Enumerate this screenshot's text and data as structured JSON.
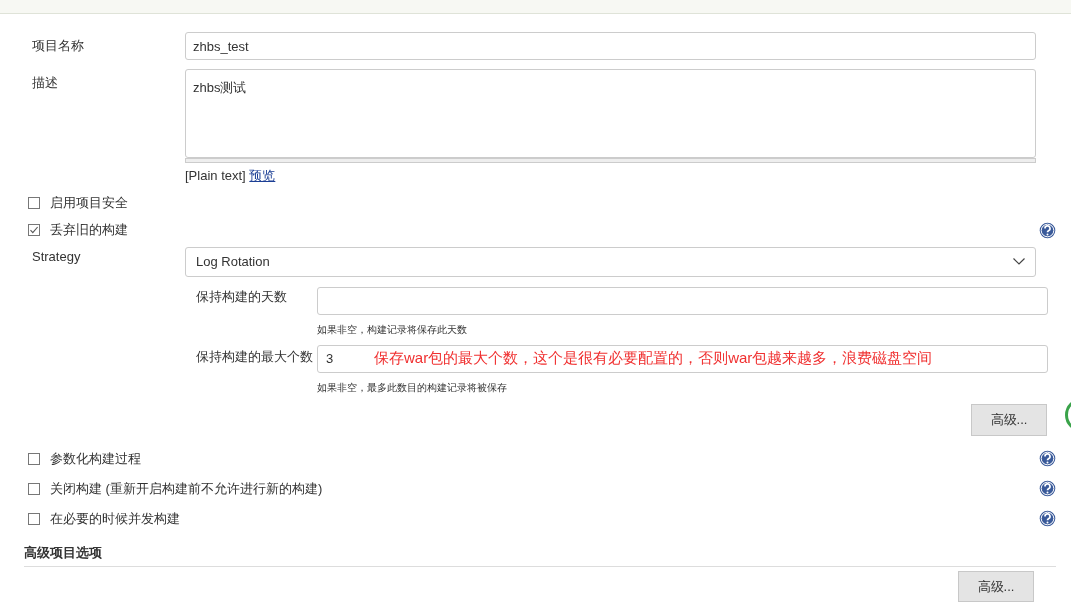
{
  "fields": [
    {
      "label": "项目名称",
      "kind": "text",
      "value": "zhbs_test"
    },
    {
      "label": "描述",
      "kind": "textarea",
      "value": "zhbs测试",
      "format": "[Plain text]",
      "link": "预览"
    }
  ],
  "options": [
    {
      "label": "启用项目安全",
      "checked": false,
      "help": false
    },
    {
      "label": "丢弃旧的构建",
      "checked": true,
      "help": true
    }
  ],
  "strategy": {
    "label": "Strategy",
    "value": "Log Rotation",
    "fields": [
      {
        "label": "保持构建的天数",
        "hint": "如果非空，构建记录将保存此天数"
      },
      {
        "label": "保持构建的最大个数",
        "value": "3",
        "annotation": "保存war包的最大个数，这个是很有必要配置的，否则war包越来越多，浪费磁盘空间",
        "hint": "如果非空，最多此数目的构建记录将被保存"
      }
    ],
    "button": "高级..."
  },
  "more_options": [
    {
      "label": "参数化构建过程",
      "checked": false,
      "help": true
    },
    {
      "label": "关闭构建 (重新开启构建前不允许进行新的构建)",
      "checked": false,
      "help": true
    },
    {
      "label": "在必要的时候并发构建",
      "checked": false,
      "help": true
    }
  ],
  "section": {
    "title": "高级项目选项",
    "button": "高级..."
  }
}
